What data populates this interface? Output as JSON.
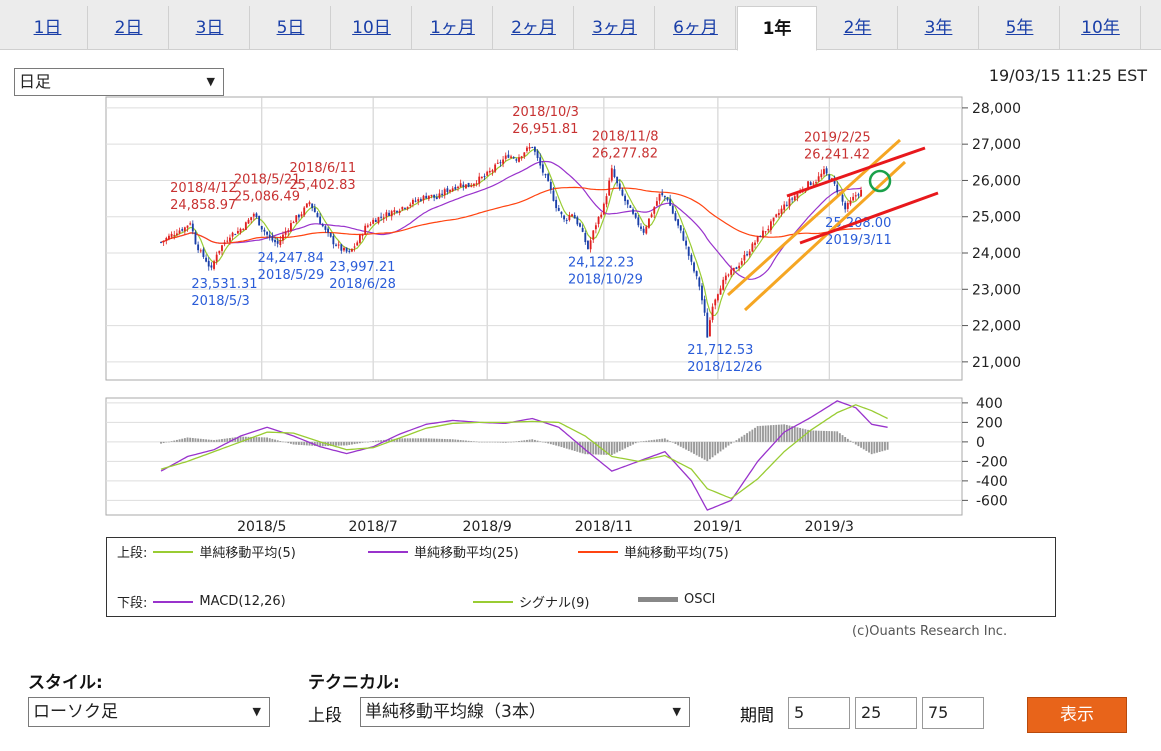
{
  "tabs": [
    {
      "label": "1日"
    },
    {
      "label": "2日"
    },
    {
      "label": "3日"
    },
    {
      "label": "5日"
    },
    {
      "label": "10日"
    },
    {
      "label": "1ヶ月"
    },
    {
      "label": "2ヶ月"
    },
    {
      "label": "3ヶ月"
    },
    {
      "label": "6ヶ月"
    },
    {
      "label": "1年"
    },
    {
      "label": "2年"
    },
    {
      "label": "3年"
    },
    {
      "label": "5年"
    },
    {
      "label": "10年"
    }
  ],
  "active_tab": "1年",
  "interval_select": "日足",
  "timestamp": "19/03/15 11:25 EST",
  "chart_data": [
    {
      "type": "candlestick",
      "panel": "upper",
      "y_ticks": [
        "28,000",
        "27,000",
        "26,000",
        "25,000",
        "24,000",
        "23,000",
        "22,000",
        "21,000"
      ],
      "ylim": [
        20500,
        28300
      ],
      "x_ticks": [
        "2018/5",
        "2018/7",
        "2018/9",
        "2018/11",
        "2019/1",
        "2019/3"
      ],
      "close_series": [
        [
          0,
          24300
        ],
        [
          3,
          24450
        ],
        [
          6,
          24600
        ],
        [
          9,
          24700
        ],
        [
          11,
          24858.97
        ],
        [
          13,
          24300
        ],
        [
          15,
          24000
        ],
        [
          17,
          23800
        ],
        [
          19,
          23531.31
        ],
        [
          21,
          24000
        ],
        [
          23,
          24200
        ],
        [
          26,
          24500
        ],
        [
          29,
          24600
        ],
        [
          32,
          24800
        ],
        [
          35,
          25086.49
        ],
        [
          38,
          24700
        ],
        [
          41,
          24400
        ],
        [
          44,
          24247.84
        ],
        [
          47,
          24600
        ],
        [
          50,
          24900
        ],
        [
          53,
          25100
        ],
        [
          56,
          25402.83
        ],
        [
          59,
          25000
        ],
        [
          62,
          24600
        ],
        [
          65,
          24300
        ],
        [
          68,
          24100
        ],
        [
          71,
          23997.21
        ],
        [
          74,
          24300
        ],
        [
          77,
          24700
        ],
        [
          80,
          24900
        ],
        [
          83,
          25000
        ],
        [
          86,
          25100
        ],
        [
          89,
          25200
        ],
        [
          92,
          25300
        ],
        [
          95,
          25400
        ],
        [
          98,
          25500
        ],
        [
          101,
          25600
        ],
        [
          104,
          25500
        ],
        [
          107,
          25700
        ],
        [
          110,
          25800
        ],
        [
          113,
          25900
        ],
        [
          116,
          25850
        ],
        [
          119,
          26000
        ],
        [
          122,
          26100
        ],
        [
          125,
          26300
        ],
        [
          128,
          26500
        ],
        [
          131,
          26700
        ],
        [
          134,
          26600
        ],
        [
          137,
          26800
        ],
        [
          140,
          26951.81
        ],
        [
          143,
          26400
        ],
        [
          146,
          25900
        ],
        [
          149,
          25300
        ],
        [
          152,
          24900
        ],
        [
          155,
          25100
        ],
        [
          158,
          24700
        ],
        [
          161,
          24122.23
        ],
        [
          164,
          24800
        ],
        [
          167,
          25300
        ],
        [
          170,
          26277.82
        ],
        [
          173,
          25700
        ],
        [
          176,
          25300
        ],
        [
          179,
          24900
        ],
        [
          182,
          24600
        ],
        [
          185,
          25100
        ],
        [
          188,
          25600
        ],
        [
          191,
          25500
        ],
        [
          194,
          24900
        ],
        [
          197,
          24400
        ],
        [
          200,
          23700
        ],
        [
          203,
          23100
        ],
        [
          205,
          22300
        ],
        [
          206,
          21712.53
        ],
        [
          208,
          22600
        ],
        [
          211,
          23100
        ],
        [
          214,
          23400
        ],
        [
          217,
          23600
        ],
        [
          220,
          23900
        ],
        [
          223,
          24200
        ],
        [
          226,
          24500
        ],
        [
          229,
          24700
        ],
        [
          232,
          25000
        ],
        [
          235,
          25300
        ],
        [
          238,
          25500
        ],
        [
          241,
          25700
        ],
        [
          244,
          25900
        ],
        [
          247,
          26000
        ],
        [
          250,
          26241.42
        ],
        [
          253,
          26000
        ],
        [
          256,
          25600
        ],
        [
          258,
          25208
        ],
        [
          260,
          25400
        ],
        [
          262,
          25600
        ],
        [
          264,
          25700
        ]
      ],
      "moving_averages": [
        {
          "name": "単純移動平均(5)",
          "color": "#99cc33"
        },
        {
          "name": "単純移動平均(25)",
          "color": "#9933cc"
        },
        {
          "name": "単純移動平均(75)",
          "color": "#ff4411"
        }
      ],
      "annotations_high": [
        {
          "date": "2018/4/12",
          "value": "24,858.97",
          "i": 11
        },
        {
          "date": "2018/5/21",
          "value": "25,086.49",
          "i": 35
        },
        {
          "date": "2018/6/11",
          "value": "25,402.83",
          "i": 56
        },
        {
          "date": "2018/10/3",
          "value": "26,951.81",
          "i": 140
        },
        {
          "date": "2018/11/8",
          "value": "26,277.82",
          "i": 170
        },
        {
          "date": "2019/2/25",
          "value": "26,241.42",
          "i": 250
        }
      ],
      "annotations_low": [
        {
          "date": "2018/5/3",
          "value": "23,531.31",
          "i": 19
        },
        {
          "date": "2018/5/29",
          "value": "24,247.84",
          "i": 44
        },
        {
          "date": "2018/6/28",
          "value": "23,997.21",
          "i": 71
        },
        {
          "date": "2018/10/29",
          "value": "24,122.23",
          "i": 161
        },
        {
          "date": "2018/12/26",
          "value": "21,712.53",
          "i": 206
        },
        {
          "date": "2019/3/11",
          "value": "25,208.00",
          "i": 258
        }
      ]
    },
    {
      "type": "line",
      "panel": "lower",
      "y_ticks": [
        "400",
        "200",
        "0",
        "-200",
        "-400",
        "-600"
      ],
      "ylim": [
        -750,
        450
      ],
      "series": [
        {
          "name": "MACD(12,26)",
          "color": "#9933cc",
          "values": [
            [
              0,
              -300
            ],
            [
              10,
              -150
            ],
            [
              20,
              -80
            ],
            [
              30,
              60
            ],
            [
              40,
              150
            ],
            [
              50,
              60
            ],
            [
              60,
              -50
            ],
            [
              70,
              -120
            ],
            [
              80,
              -50
            ],
            [
              90,
              80
            ],
            [
              100,
              180
            ],
            [
              110,
              220
            ],
            [
              120,
              200
            ],
            [
              130,
              190
            ],
            [
              140,
              240
            ],
            [
              150,
              150
            ],
            [
              160,
              -80
            ],
            [
              170,
              -300
            ],
            [
              180,
              -200
            ],
            [
              190,
              -100
            ],
            [
              200,
              -400
            ],
            [
              206,
              -700
            ],
            [
              215,
              -600
            ],
            [
              225,
              -200
            ],
            [
              235,
              100
            ],
            [
              245,
              250
            ],
            [
              255,
              420
            ],
            [
              262,
              350
            ],
            [
              268,
              180
            ],
            [
              274,
              150
            ]
          ]
        },
        {
          "name": "シグナル(9)",
          "color": "#99cc33",
          "values": [
            [
              0,
              -280
            ],
            [
              10,
              -200
            ],
            [
              20,
              -100
            ],
            [
              30,
              0
            ],
            [
              40,
              100
            ],
            [
              50,
              90
            ],
            [
              60,
              0
            ],
            [
              70,
              -80
            ],
            [
              80,
              -60
            ],
            [
              90,
              40
            ],
            [
              100,
              140
            ],
            [
              110,
              190
            ],
            [
              120,
              200
            ],
            [
              130,
              200
            ],
            [
              140,
              210
            ],
            [
              150,
              200
            ],
            [
              160,
              60
            ],
            [
              170,
              -150
            ],
            [
              180,
              -200
            ],
            [
              190,
              -140
            ],
            [
              200,
              -280
            ],
            [
              206,
              -480
            ],
            [
              215,
              -580
            ],
            [
              225,
              -380
            ],
            [
              235,
              -100
            ],
            [
              245,
              120
            ],
            [
              255,
              300
            ],
            [
              262,
              380
            ],
            [
              268,
              320
            ],
            [
              274,
              240
            ]
          ]
        }
      ],
      "osci_name": "OSCI"
    }
  ],
  "legend": {
    "upper_label": "上段:",
    "lower_label": "下段:",
    "upper": [
      {
        "name": "単純移動平均(5)",
        "color": "#99cc33"
      },
      {
        "name": "単純移動平均(25)",
        "color": "#9933cc"
      },
      {
        "name": "単純移動平均(75)",
        "color": "#ff4411"
      }
    ],
    "lower": [
      {
        "name": "MACD(12,26)",
        "color": "#9933cc"
      },
      {
        "name": "シグナル(9)",
        "color": "#99cc33"
      },
      {
        "name": "OSCI",
        "color": "#888888"
      }
    ]
  },
  "copyright": "(c)Ouants Research Inc.",
  "controls": {
    "style_label": "スタイル:",
    "style_value": "ローソク足",
    "technical_label": "テクニカル:",
    "upper_label": "上段",
    "technical_value": "単純移動平均線（3本）",
    "period_label": "期間",
    "period_values": [
      "5",
      "25",
      "75"
    ],
    "submit_label": "表示"
  }
}
